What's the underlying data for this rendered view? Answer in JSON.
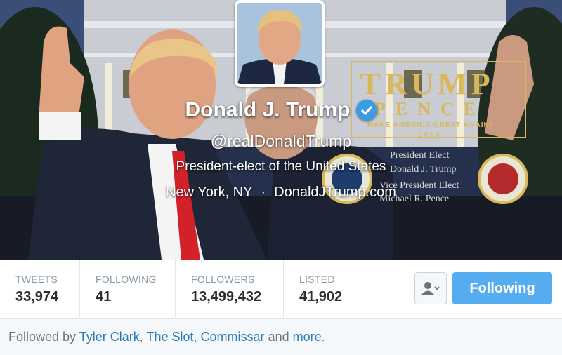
{
  "profile": {
    "name": "Donald J. Trump",
    "handle": "@realDonaldTrump",
    "bio": "President-elect of the United States",
    "location": "New York, NY",
    "separator": "·",
    "website": "DonaldJTrump.com"
  },
  "banner": {
    "logo_line1": "TRUMP",
    "logo_line2": "PENCE",
    "slogan": "MAKE AMERICA GREAT AGAIN!",
    "year": "2016",
    "caption1": "President Elect",
    "caption2": "Donald J. Trump",
    "caption3": "Vice President Elect",
    "caption4": "Michael R. Pence"
  },
  "stats": [
    {
      "label": "TWEETS",
      "value": "33,974"
    },
    {
      "label": "FOLLOWING",
      "value": "41"
    },
    {
      "label": "FOLLOWERS",
      "value": "13,499,432"
    },
    {
      "label": "LISTED",
      "value": "41,902"
    }
  ],
  "actions": {
    "follow_label": "Following",
    "user_menu_icon": "person-dropdown-icon"
  },
  "followed_by": {
    "prefix": "Followed by",
    "users": [
      "Tyler Clark",
      "The Slot",
      "Commissar"
    ],
    "sep1": ",",
    "sep2": ",",
    "and": "and",
    "more": "more",
    "end": "."
  },
  "colors": {
    "accent": "#55acee",
    "link": "#2b7bb9",
    "verified": "#3b9be3",
    "gold": "#d9b85a"
  }
}
